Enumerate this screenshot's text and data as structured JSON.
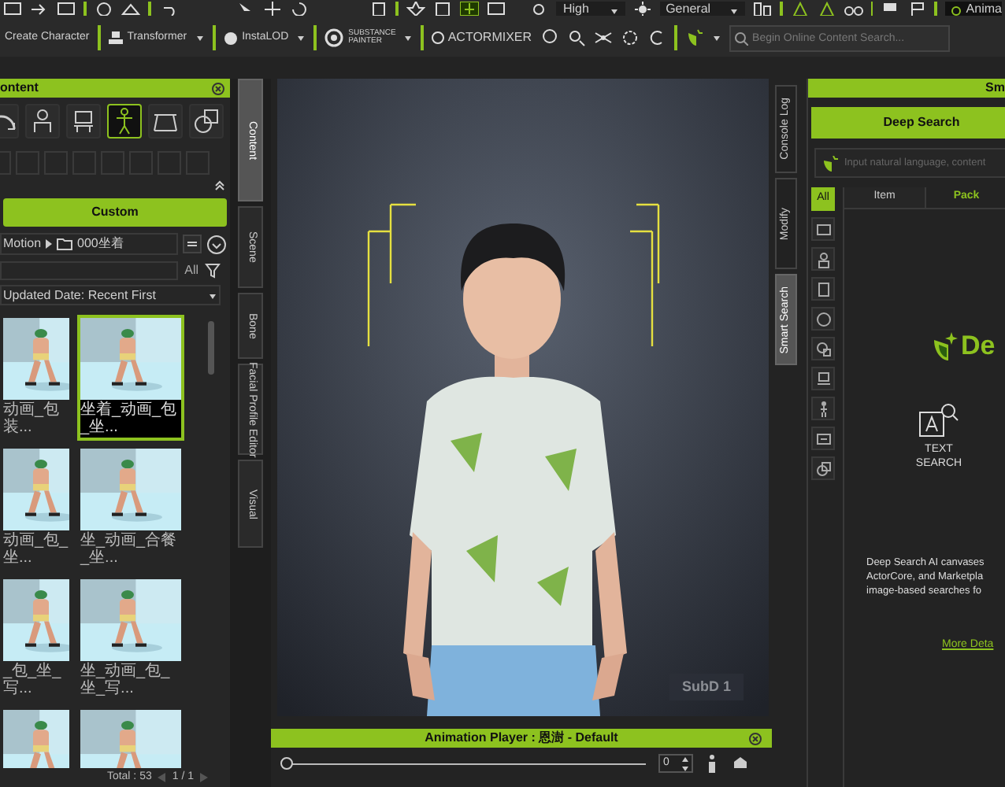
{
  "toolbar": {
    "quality": "High",
    "mode": "General",
    "animation_button": "Anima",
    "tools": [
      "Create Character",
      "Transformer",
      "InstaLOD"
    ],
    "substance": [
      "SUBSTANCE",
      "PAINTER"
    ],
    "actormixer": "ACTORMIXER",
    "search": {
      "placeholder": "Begin Online Content Search..."
    }
  },
  "left_tabs": [
    {
      "label": "Content",
      "selected": true
    },
    {
      "label": "Scene",
      "selected": false
    },
    {
      "label": "Bone",
      "selected": false
    },
    {
      "label": "Facial Profile Editor",
      "selected": false
    },
    {
      "label": "Visual",
      "selected": false
    }
  ],
  "content_panel": {
    "title": "ontent",
    "categories": [
      {
        "selected": false
      },
      {
        "selected": false
      },
      {
        "selected": false
      },
      {
        "selected": true
      },
      {
        "selected": false
      },
      {
        "selected": false
      }
    ],
    "custom_button": "Custom",
    "breadcrumb": [
      "Motion",
      "000坐着"
    ],
    "filter": "All",
    "sort": "Updated Date: Recent First",
    "items": [
      {
        "caption": "动画_包装...",
        "selected": false
      },
      {
        "caption": "坐着_动画_包_坐...",
        "selected": true
      },
      {
        "caption": "动画_包_坐...",
        "selected": false
      },
      {
        "caption": "坐_动画_合餐_坐...",
        "selected": false
      },
      {
        "caption": "_包_坐_写...",
        "selected": false
      },
      {
        "caption": "坐_动画_包_坐_写...",
        "selected": false
      },
      {
        "selected": false
      },
      {
        "selected": false
      }
    ],
    "total": "Total : 53",
    "page": "1 / 1"
  },
  "viewport": {
    "subd_label": "SubD 1"
  },
  "animation_player": {
    "title": "Animation Player : 恩澍 - Default",
    "frame": "0",
    "level": 0
  },
  "right_tabs": [
    {
      "label": "Console Log",
      "selected": false
    },
    {
      "label": "Modify",
      "selected": false
    },
    {
      "label": "Smart Search",
      "selected": true
    }
  ],
  "smart_search": {
    "title": "Sm",
    "deep_search_button": "Deep Search",
    "placeholder": "Input natural language, content",
    "tabs": [
      {
        "label": "Item",
        "selected": false
      },
      {
        "label": "Pack",
        "selected": true
      }
    ],
    "categories": [
      {
        "label": "All",
        "selected": true
      },
      {
        "selected": false
      },
      {
        "selected": false
      },
      {
        "selected": false
      },
      {
        "selected": false
      },
      {
        "selected": false
      },
      {
        "selected": false
      },
      {
        "selected": false
      },
      {
        "selected": false
      },
      {
        "selected": false
      }
    ],
    "brand": "De",
    "text_search": "TEXT SEARCH",
    "description": [
      "Deep Search AI canvases",
      "ActorCore, and Marketpla",
      "image-based searches fo"
    ],
    "more_link": "More Deta"
  }
}
